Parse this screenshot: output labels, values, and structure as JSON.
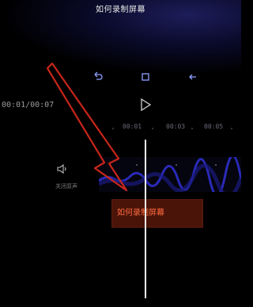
{
  "video": {
    "title": "如何录制屏幕"
  },
  "player": {
    "timecode": "00:01/00:07"
  },
  "timeline": {
    "ticks": [
      "00:01",
      "00:03",
      "00:05"
    ]
  },
  "audio": {
    "label": "关闭原声"
  },
  "subtitle": {
    "text": "如何录制屏幕"
  },
  "icons": {
    "undo": "undo-icon",
    "fullscreen": "fullscreen-icon",
    "back": "arrow-left-icon",
    "play": "play-icon",
    "volume": "volume-icon"
  },
  "colors": {
    "subtitle_bg": "#4b1409",
    "subtitle_text": "#ff6a3d",
    "annotation_arrow": "#c8261a",
    "playhead": "#f2f2f2"
  }
}
